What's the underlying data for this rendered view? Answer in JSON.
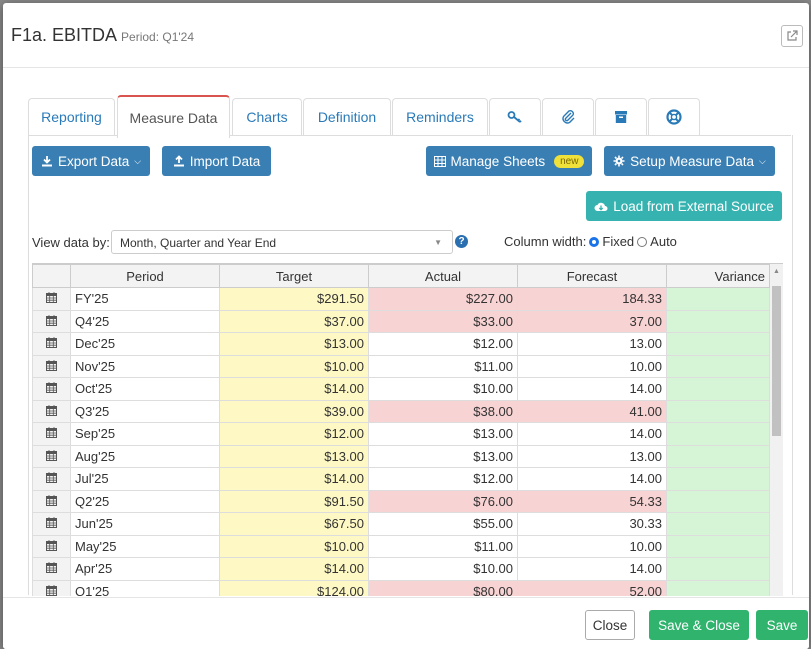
{
  "modal": {
    "title": "F1a. EBITDA",
    "period_label": "Period: Q1'24"
  },
  "tabs": [
    {
      "label": "Reporting"
    },
    {
      "label": "Measure Data"
    },
    {
      "label": "Charts"
    },
    {
      "label": "Definition"
    },
    {
      "label": "Reminders"
    }
  ],
  "icon_tabs": [
    "key-icon",
    "paperclip-icon",
    "archive-icon",
    "lifebuoy-icon"
  ],
  "toolbar": {
    "export_label": "Export Data",
    "import_label": "Import Data",
    "manage_sheets_label": "Manage Sheets",
    "new_badge": "new",
    "setup_label": "Setup Measure Data",
    "load_external_label": "Load from External Source"
  },
  "view": {
    "label": "View data by:",
    "selected": "Month, Quarter and Year End",
    "column_width_label": "Column width:",
    "fixed_label": "Fixed",
    "auto_label": "Auto",
    "selected_width": "Fixed"
  },
  "table": {
    "columns": [
      "Period",
      "Target",
      "Actual",
      "Forecast",
      "Variance"
    ],
    "rows": [
      {
        "period": "FY'25",
        "target": "$291.50",
        "actual": "$227.00",
        "forecast": "184.33",
        "actual_red": true
      },
      {
        "period": "Q4'25",
        "target": "$37.00",
        "actual": "$33.00",
        "forecast": "37.00",
        "actual_red": true
      },
      {
        "period": "Dec'25",
        "target": "$13.00",
        "actual": "$12.00",
        "forecast": "13.00",
        "actual_red": false
      },
      {
        "period": "Nov'25",
        "target": "$10.00",
        "actual": "$11.00",
        "forecast": "10.00",
        "actual_red": false
      },
      {
        "period": "Oct'25",
        "target": "$14.00",
        "actual": "$10.00",
        "forecast": "14.00",
        "actual_red": false
      },
      {
        "period": "Q3'25",
        "target": "$39.00",
        "actual": "$38.00",
        "forecast": "41.00",
        "actual_red": true
      },
      {
        "period": "Sep'25",
        "target": "$12.00",
        "actual": "$13.00",
        "forecast": "14.00",
        "actual_red": false
      },
      {
        "period": "Aug'25",
        "target": "$13.00",
        "actual": "$13.00",
        "forecast": "13.00",
        "actual_red": false
      },
      {
        "period": "Jul'25",
        "target": "$14.00",
        "actual": "$12.00",
        "forecast": "14.00",
        "actual_red": false
      },
      {
        "period": "Q2'25",
        "target": "$91.50",
        "actual": "$76.00",
        "forecast": "54.33",
        "actual_red": true
      },
      {
        "period": "Jun'25",
        "target": "$67.50",
        "actual": "$55.00",
        "forecast": "30.33",
        "actual_red": false
      },
      {
        "period": "May'25",
        "target": "$10.00",
        "actual": "$11.00",
        "forecast": "10.00",
        "actual_red": false
      },
      {
        "period": "Apr'25",
        "target": "$14.00",
        "actual": "$10.00",
        "forecast": "14.00",
        "actual_red": false
      },
      {
        "period": "Q1'25",
        "target": "$124.00",
        "actual": "$80.00",
        "forecast": "52.00",
        "actual_red": true
      }
    ]
  },
  "footer": {
    "close_label": "Close",
    "save_close_label": "Save & Close",
    "save_label": "Save"
  },
  "colors": {
    "target_bg": "#fef9c4",
    "actual_bad_bg": "#f8d3d3",
    "variance_bg": "#d6f5d6",
    "primary": "#3a7fb3",
    "teal": "#36b3b0",
    "save_green": "#2fb36d",
    "active_tab_accent": "#d9534f"
  }
}
